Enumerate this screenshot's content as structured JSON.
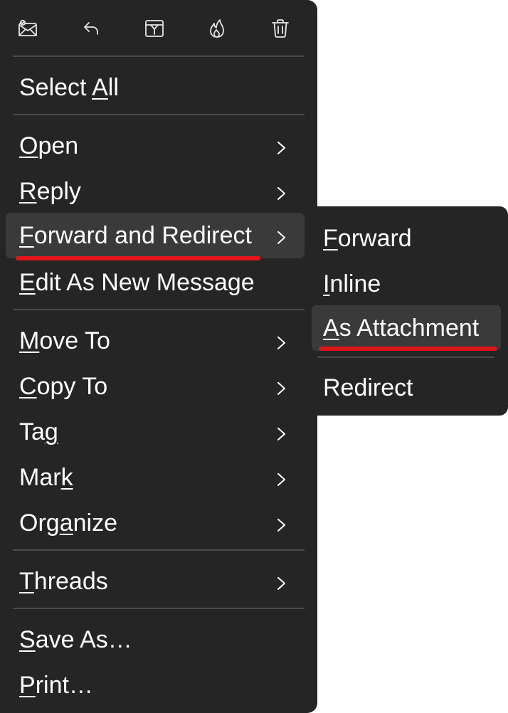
{
  "toolbar": {
    "icons": [
      "mail-read-icon",
      "reply-icon",
      "archive-icon",
      "junk-flame-icon",
      "trash-icon"
    ]
  },
  "menu": {
    "items": [
      {
        "pre": "Select ",
        "acc": "A",
        "post": "ll",
        "submenu": false
      },
      {
        "pre": "",
        "acc": "O",
        "post": "pen",
        "submenu": true
      },
      {
        "pre": "",
        "acc": "R",
        "post": "eply",
        "submenu": true
      },
      {
        "pre": "",
        "acc": "F",
        "post": "orward and Redirect",
        "submenu": true
      },
      {
        "pre": "",
        "acc": "E",
        "post": "dit As New Message",
        "submenu": false
      },
      {
        "pre": "",
        "acc": "M",
        "post": "ove To",
        "submenu": true
      },
      {
        "pre": "",
        "acc": "C",
        "post": "opy To",
        "submenu": true
      },
      {
        "pre": "Ta",
        "acc": "g",
        "post": "",
        "submenu": true
      },
      {
        "pre": "Mar",
        "acc": "k",
        "post": "",
        "submenu": true
      },
      {
        "pre": "Org",
        "acc": "a",
        "post": "nize",
        "submenu": true
      },
      {
        "pre": "",
        "acc": "T",
        "post": "hreads",
        "submenu": true
      },
      {
        "pre": "",
        "acc": "S",
        "post": "ave As…",
        "submenu": false
      },
      {
        "pre": "",
        "acc": "P",
        "post": "rint…",
        "submenu": false
      }
    ]
  },
  "submenu": {
    "items": [
      {
        "pre": "",
        "acc": "F",
        "post": "orward"
      },
      {
        "pre": "",
        "acc": "I",
        "post": "nline"
      },
      {
        "pre": "",
        "acc": "A",
        "post": "s Attachment"
      },
      {
        "pre": "Redirect",
        "acc": "",
        "post": ""
      }
    ]
  },
  "colors": {
    "menu_bg": "#252525",
    "hover_bg": "#3a3a3a",
    "separator": "#4a4a4a",
    "text": "#ffffff",
    "annotation_underline": "#e0161a"
  }
}
